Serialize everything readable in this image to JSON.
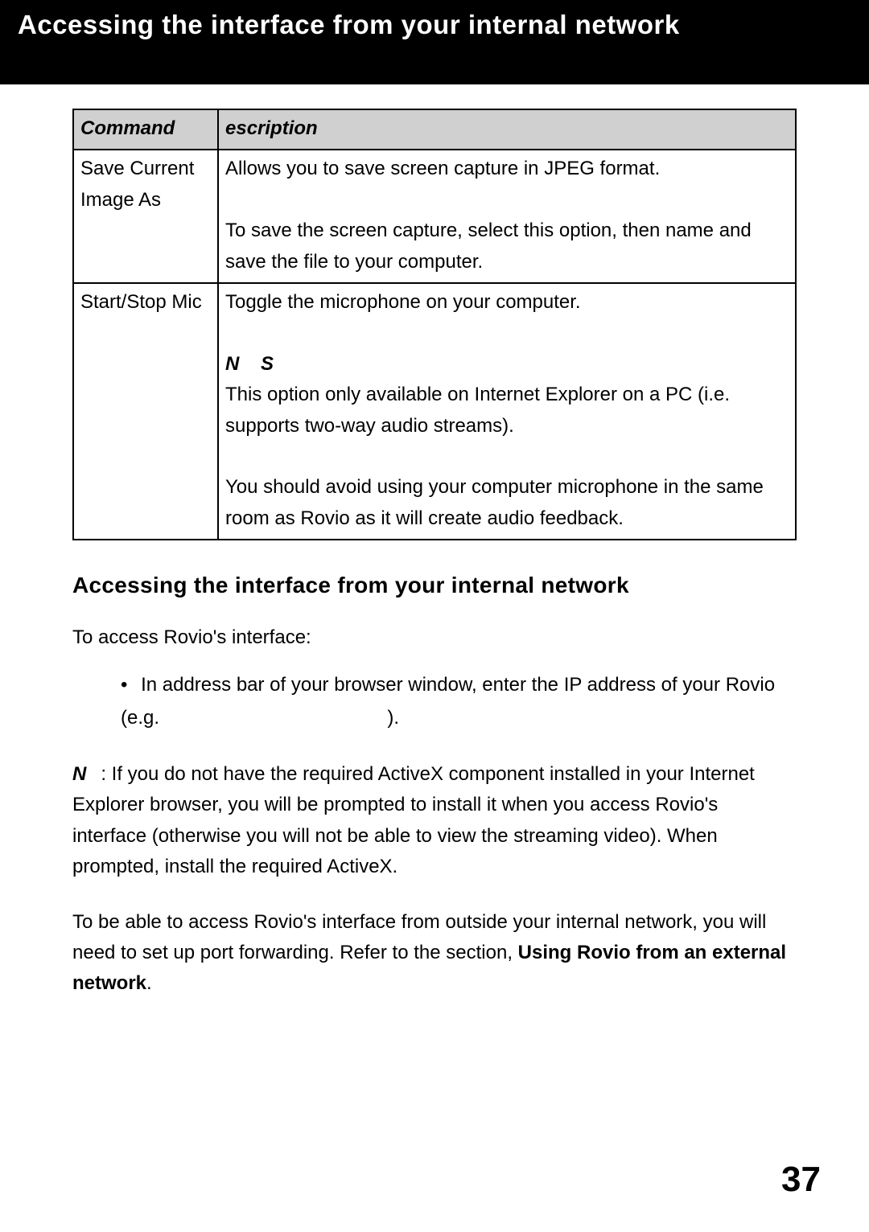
{
  "header": {
    "title": "Accessing the interface from your internal network"
  },
  "table": {
    "headers": {
      "command": "Command",
      "description": "escription"
    },
    "rows": [
      {
        "command": "Save Current Image As",
        "desc_line1": "Allows you to save screen capture in JPEG format.",
        "desc_line2": "To save the screen capture, select this option, then name and save the file to your computer."
      },
      {
        "command": "Start/Stop Mic",
        "desc_line1": "Toggle the microphone on your computer.",
        "note_lead": "N    S",
        "desc_line2": "This option only available on Internet Explorer on a PC (i.e. supports two-way audio streams).",
        "desc_line3": "You should avoid using your computer microphone in the same room as Rovio as it will create audio feedback."
      }
    ]
  },
  "section_heading": "Accessing the interface from your internal network",
  "intro": "To access Rovio's interface:",
  "bullet": {
    "line1": "In address bar of your browser window, enter the IP address of your Rovio",
    "line2_prefix": "(e.g.",
    "line2_suffix": ")."
  },
  "note": {
    "lead": "N",
    "body": ": If you do not have the required ActiveX component installed in your Internet Explorer browser, you will be prompted to install it when you access Rovio's interface (otherwise you will not be able to view the streaming video). When prompted, install the required ActiveX."
  },
  "closing": {
    "part1": "To be able to access Rovio's interface from outside your internal network, you will need to set up port forwarding. Refer to the section, ",
    "bold": "Using Rovio from an external network",
    "part2": "."
  },
  "page_number": "37"
}
